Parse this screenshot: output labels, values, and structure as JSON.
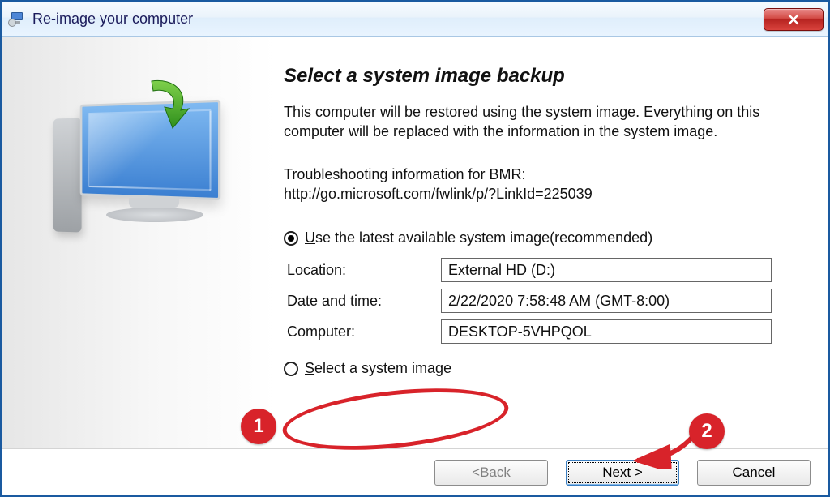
{
  "titlebar": {
    "title": "Re-image your computer"
  },
  "main": {
    "heading": "Select a system image backup",
    "description": "This computer will be restored using the system image. Everything on this computer will be replaced with the information in the system image.",
    "troubleshoot_label": "Troubleshooting information for BMR:",
    "troubleshoot_link": "http://go.microsoft.com/fwlink/p/?LinkId=225039",
    "option_latest_prefix": "U",
    "option_latest_rest": "se the latest available system image(recommended)",
    "fields": {
      "location_label": "Location:",
      "location_value": "External HD (D:)",
      "datetime_label": "Date and time:",
      "datetime_value": "2/22/2020 7:58:48 AM (GMT-8:00)",
      "computer_label": "Computer:",
      "computer_value": "DESKTOP-5VHPQOL"
    },
    "option_select_prefix": "S",
    "option_select_rest": "elect a system image"
  },
  "footer": {
    "back_prefix": "< ",
    "back_mn": "B",
    "back_rest": "ack",
    "next_mn": "N",
    "next_rest": "ext >",
    "cancel": "Cancel"
  },
  "annotations": {
    "badge1": "1",
    "badge2": "2"
  }
}
